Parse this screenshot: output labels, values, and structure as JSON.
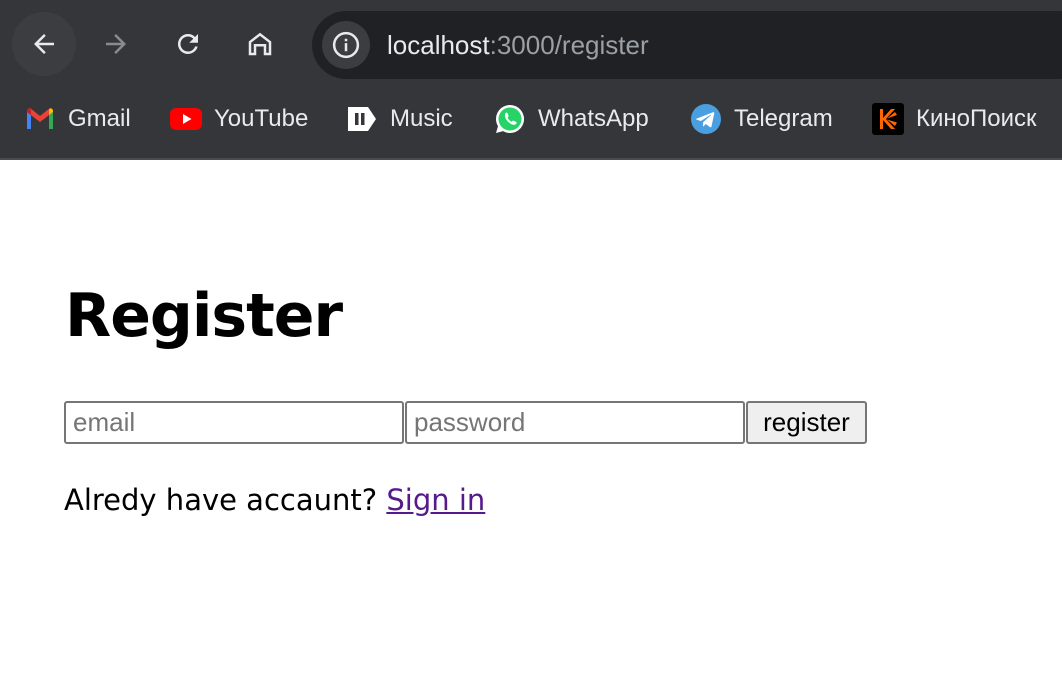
{
  "browser": {
    "url_host": "localhost",
    "url_path": ":3000/register",
    "bookmarks": [
      {
        "label": "Gmail",
        "icon": "gmail-icon"
      },
      {
        "label": "YouTube",
        "icon": "youtube-icon"
      },
      {
        "label": "Music",
        "icon": "music-icon"
      },
      {
        "label": "WhatsApp",
        "icon": "whatsapp-icon"
      },
      {
        "label": "Telegram",
        "icon": "telegram-icon"
      },
      {
        "label": "КиноПоиск",
        "icon": "kinopoisk-icon"
      }
    ],
    "colors": {
      "chrome_bg": "#35363a",
      "omnibox_bg": "#202124",
      "text": "#e8eaed",
      "muted_text": "#9aa0a6"
    }
  },
  "page": {
    "title": "Register",
    "email_placeholder": "email",
    "password_placeholder": "password",
    "submit_label": "register",
    "prompt_text": "Alredy have accaunt? ",
    "signin_label": "Sign in",
    "colors": {
      "link": "#551a8b"
    }
  }
}
